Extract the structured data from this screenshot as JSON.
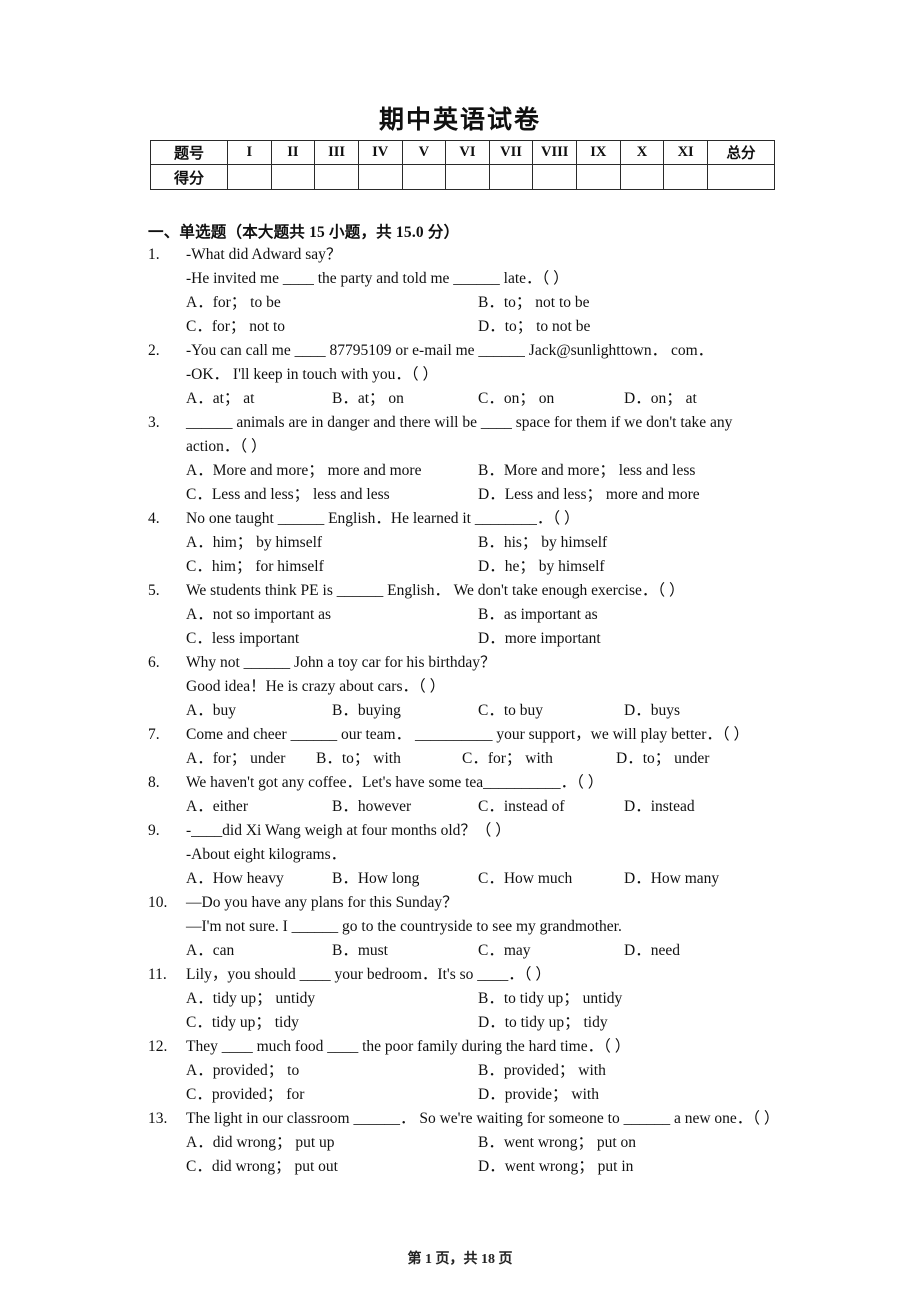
{
  "document": {
    "title": "期中英语试卷",
    "footer": "第 1 页，共 18 页"
  },
  "score_table": {
    "row_labels": [
      "题号",
      "得分"
    ],
    "columns": [
      "I",
      "II",
      "III",
      "IV",
      "V",
      "VI",
      "VII",
      "VIII",
      "IX",
      "X",
      "XI"
    ],
    "total_label": "总分",
    "scores": [
      "",
      "",
      "",
      "",
      "",
      "",
      "",
      "",
      "",
      "",
      "",
      ""
    ]
  },
  "section": {
    "heading": "一、单选题（本大题共 15 小题，共 15.0 分）"
  },
  "questions": [
    {
      "num": "1.",
      "lines": [
        "-What did Adward say？",
        "-He invited me ____ the party and told me ______ late．（      ）"
      ],
      "layout": "two-col",
      "options": [
        "A．for；  to be",
        "B．to；  not to be",
        "C．for；  not to",
        "D．to；  to not be"
      ]
    },
    {
      "num": "2.",
      "lines": [
        "-You can call me ____ 87795109 or e-mail me ______ Jack@sunlighttown．  com．",
        "-OK．  I'll keep in touch with you．（      ）"
      ],
      "layout": "four-col",
      "options": [
        "A．at；  at",
        "B．at；  on",
        "C．on；  on",
        "D．on；  at"
      ]
    },
    {
      "num": "3.",
      "lines": [
        "______ animals are in danger and there will be ____ space for them if we don't take any action．（      ）"
      ],
      "layout": "two-col",
      "options": [
        "A．More and more；  more and more",
        "B．More and more；  less and less",
        "C．Less and less；  less and less",
        "D．Less and less；  more and more"
      ]
    },
    {
      "num": "4.",
      "lines": [
        "No one taught ______ English．He learned it ________．（      ）"
      ],
      "layout": "two-col",
      "options": [
        "A．him；  by himself",
        "B．his；  by himself",
        "C．him；  for himself",
        "D．he；  by himself"
      ]
    },
    {
      "num": "5.",
      "lines": [
        "We students think PE is ______ English．  We don't take enough exercise．（      ）"
      ],
      "layout": "two-col",
      "options": [
        "A．not so important as",
        "B．as important as",
        "C．less important",
        "D．more important"
      ]
    },
    {
      "num": "6.",
      "lines": [
        "Why not ______ John a toy car for his birthday？",
        "Good idea！He is crazy about cars．（      ）"
      ],
      "layout": "four-col",
      "options": [
        "A．buy",
        "B．buying",
        "C．to buy",
        "D．buys"
      ]
    },
    {
      "num": "7.",
      "lines": [
        "Come and cheer ______ our team．  __________ your support，we will play better．（      ）"
      ],
      "layout": "four-col-narrow",
      "options": [
        "A．for；  under",
        "B．to；  with",
        "C．for；  with",
        "D．to；  under"
      ]
    },
    {
      "num": "8.",
      "lines": [
        "We haven't got any coffee．Let's have some tea__________．（      ）"
      ],
      "layout": "four-col",
      "options": [
        "A．either",
        "B．however",
        "C．instead of",
        "D．instead"
      ]
    },
    {
      "num": "9.",
      "lines": [
        "-____did Xi Wang weigh at four months old？（      ）",
        "-About eight kilograms．"
      ],
      "layout": "four-col",
      "options": [
        "A．How heavy",
        "B．How long",
        "C．How much",
        "D．How many"
      ]
    },
    {
      "num": "10.",
      "lines": [
        "—Do you have any plans for this Sunday？",
        "—I'm not sure. I ______ go to the countryside to see my grandmother."
      ],
      "layout": "four-col",
      "options": [
        "A．can",
        "B．must",
        "C．may",
        "D．need"
      ]
    },
    {
      "num": "11.",
      "lines": [
        "Lily，you should ____ your bedroom．It's so ____．（      ）"
      ],
      "layout": "two-col",
      "options": [
        "A．tidy up；  untidy",
        "B．to tidy up；  untidy",
        "C．tidy up；  tidy",
        "D．to tidy up；  tidy"
      ]
    },
    {
      "num": "12.",
      "lines": [
        "They ____ much food ____ the poor family during the hard time．（      ）"
      ],
      "layout": "two-col",
      "options": [
        "A．provided；  to",
        "B．provided；  with",
        "C．provided；  for",
        "D．provide；  with"
      ]
    },
    {
      "num": "13.",
      "lines": [
        "The light in our classroom ______．  So we're waiting for someone to ______ a new one．（      ）"
      ],
      "layout": "two-col",
      "options": [
        "A．did wrong；  put up",
        "B．went wrong；  put on",
        "C．did wrong；  put out",
        "D．went wrong；  put in"
      ]
    }
  ]
}
